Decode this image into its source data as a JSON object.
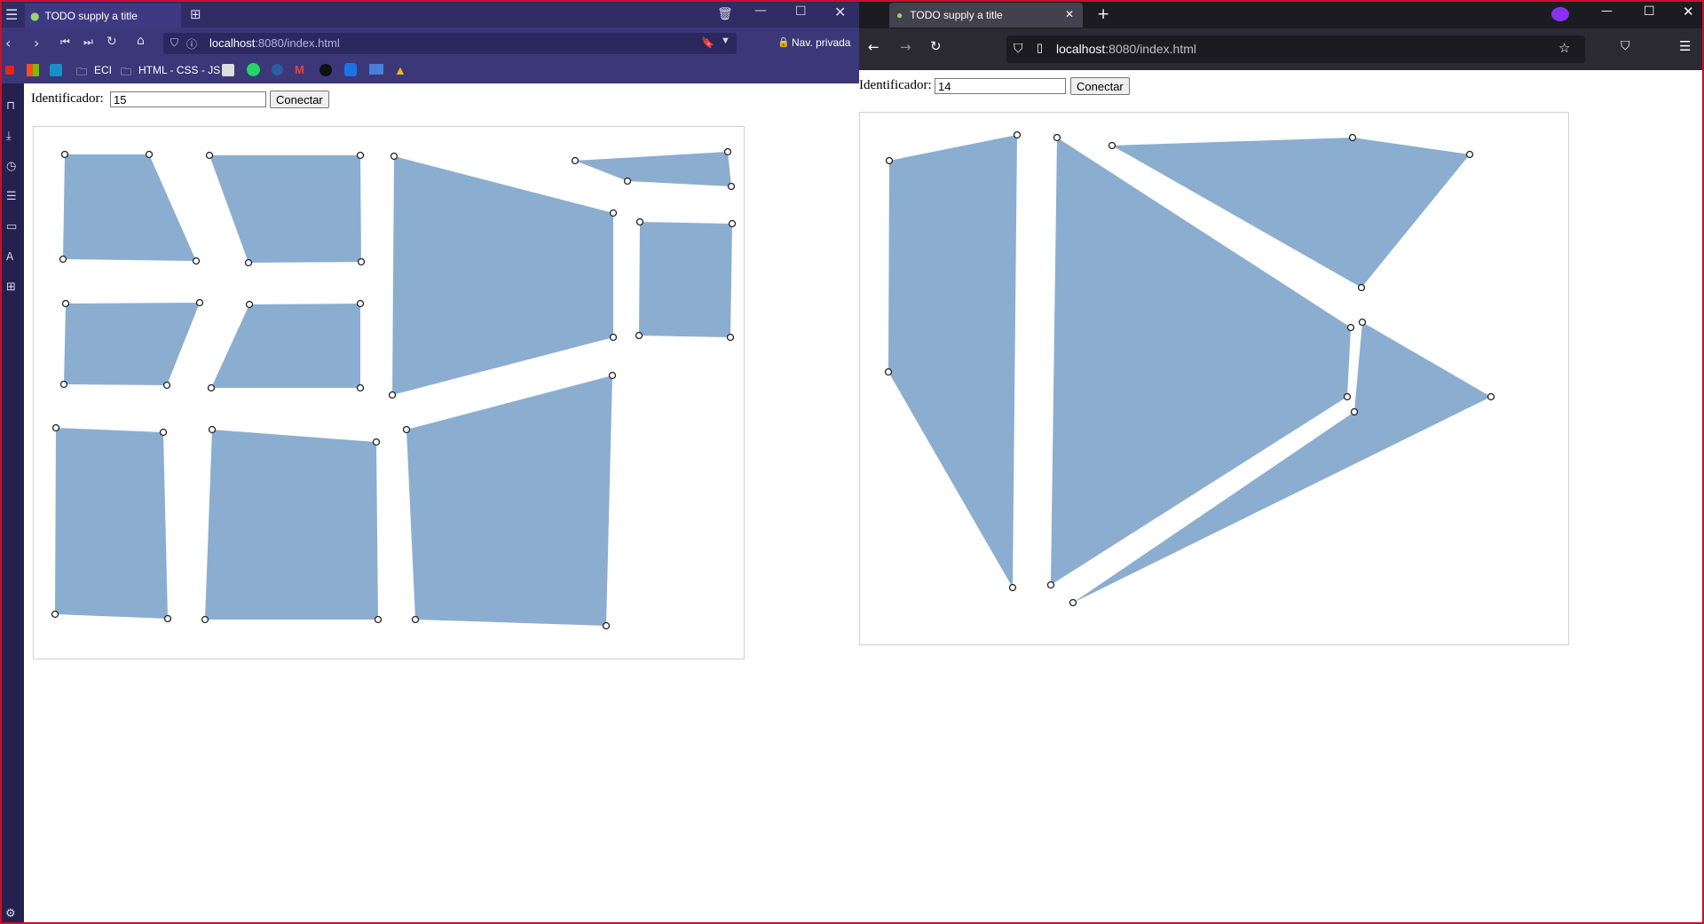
{
  "left_window": {
    "tab_title": "TODO supply a title",
    "url_host": "localhost",
    "url_rest": ":8080/index.html",
    "private_label": "Nav. privada",
    "bookmarks": [
      {
        "label": "ECI",
        "icon": "folder-icon"
      },
      {
        "label": "HTML - CSS - JS",
        "icon": "folder-icon"
      }
    ],
    "form": {
      "label": "Identificador:",
      "value": "15",
      "button": "Conectar"
    },
    "shape_fill": "#8badd0"
  },
  "right_window": {
    "tab_title": "TODO supply a title",
    "url_host": "localhost",
    "url_rest": ":8080/index.html",
    "form": {
      "label": "Identificador:",
      "value": "14",
      "button": "Conectar"
    },
    "shape_fill": "#8badd0"
  },
  "colors": {
    "opera_tabbar": "#2f2c66",
    "opera_toolbar": "#3b3779",
    "firefox_tabbar": "#1c1b22",
    "firefox_toolbar": "#2b2a33",
    "frame_accent": "#c8102e"
  }
}
